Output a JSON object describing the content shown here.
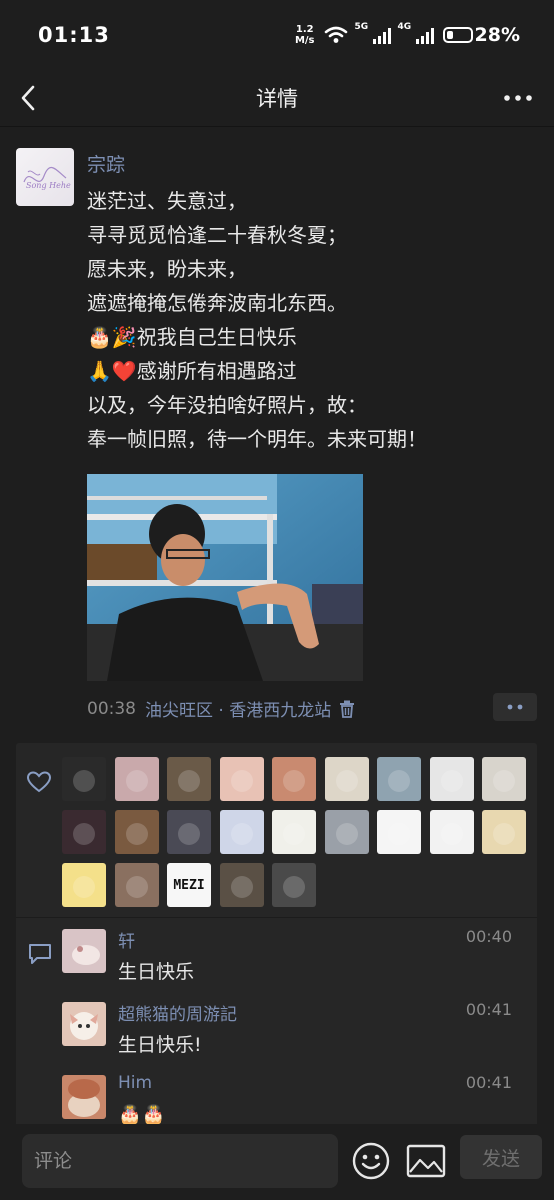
{
  "status_bar": {
    "time": "01:13",
    "net_speed_value": "1.2",
    "net_speed_unit": "M/s",
    "sim1": "5G",
    "sim2": "4G",
    "battery": "28%"
  },
  "nav": {
    "title": "详情"
  },
  "post": {
    "author": "宗踪",
    "lines": [
      "迷茫过、失意过，",
      "寻寻觅觅恰逢二十春秋冬夏；",
      "愿未来，盼未来，",
      "遮遮掩掩怎倦奔波南北东西。",
      "🎂🎉祝我自己生日快乐",
      "🙏❤️感谢所有相遇路过",
      "以及，今年没拍啥好照片，故：",
      "奉一帧旧照，待一个明年。未来可期！"
    ],
    "time": "00:38",
    "location": "油尖旺区 · 香港西九龙站",
    "avatar_signature": "Song Hehe"
  },
  "likes": {
    "avatar_colors": [
      "#2a2a2a",
      "#c9a9ab",
      "#6a5a48",
      "#e8c2b5",
      "#c98a70",
      "#ddd6c8",
      "#8fa3b0",
      "#e6e6e6",
      "#d8d4cc",
      "#3a2a30",
      "#7a5a40",
      "#4a4a55",
      "#cfd6e8",
      "#f0f0ea",
      "#9aa0a8",
      "#f5f5f5",
      "#f2f2f2",
      "#e8d8b0",
      "#f4e08a",
      "#8a7060",
      "#f7f7f7",
      "#5a5045",
      "#4a4a4a"
    ],
    "mezi_text": "MEZI"
  },
  "comments": [
    {
      "name": "轩",
      "time": "00:40",
      "text": "生日快乐",
      "avatar_color": "#d9c4c6"
    },
    {
      "name": "超熊猫的周游記",
      "time": "00:41",
      "text": "生日快乐!",
      "avatar_color": "#e3c6b8"
    },
    {
      "name": "Him",
      "time": "00:41",
      "text": "🎂🎂",
      "avatar_color": "#c9876a"
    }
  ],
  "input": {
    "placeholder": "评论",
    "send_label": "发送"
  }
}
